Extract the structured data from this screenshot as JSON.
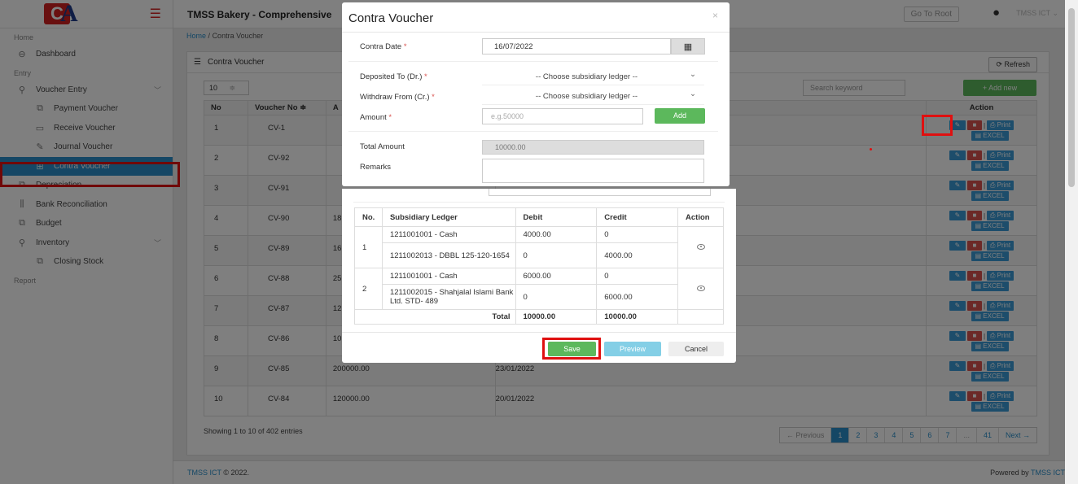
{
  "sidebar": {
    "items": [
      {
        "type": "section",
        "label": "Home"
      },
      {
        "type": "item",
        "label": "Dashboard",
        "icon": "dashboard-icon",
        "glyph": "⊖"
      },
      {
        "type": "section",
        "label": "Entry"
      },
      {
        "type": "item",
        "label": "Voucher Entry",
        "icon": "voucher-entry-icon",
        "glyph": "⚲",
        "chev": "﹀"
      },
      {
        "type": "sub",
        "label": "Payment Voucher",
        "icon": "payment-voucher-icon",
        "glyph": "⧉"
      },
      {
        "type": "sub",
        "label": "Receive Voucher",
        "icon": "receive-voucher-icon",
        "glyph": "▭"
      },
      {
        "type": "sub",
        "label": "Journal Voucher",
        "icon": "journal-voucher-icon",
        "glyph": "✎"
      },
      {
        "type": "sub",
        "label": "Contra Voucher",
        "icon": "contra-voucher-icon",
        "glyph": "⊞",
        "active": true
      },
      {
        "type": "item",
        "label": "Depreciation",
        "icon": "depreciation-icon",
        "glyph": "⧉"
      },
      {
        "type": "item",
        "label": "Bank Reconciliation",
        "icon": "bank-reconciliation-icon",
        "glyph": "⫼"
      },
      {
        "type": "item",
        "label": "Budget",
        "icon": "budget-icon",
        "glyph": "⧉"
      },
      {
        "type": "item",
        "label": "Inventory",
        "icon": "inventory-icon",
        "glyph": "⚲",
        "chev": "﹀"
      },
      {
        "type": "sub",
        "label": "Closing Stock",
        "icon": "closing-stock-icon",
        "glyph": "⧉"
      },
      {
        "type": "section",
        "label": "Report"
      }
    ]
  },
  "topbar": {
    "app_title": "TMSS Bakery - Comprehensive",
    "go_root": "Go To Root",
    "user_name": "TMSS ICT ⌄"
  },
  "breadcrumb": {
    "home": "Home",
    "sep": "/",
    "current": "Contra Voucher"
  },
  "panel": {
    "title": "Contra Voucher",
    "refresh": "Refresh",
    "page_length": "10",
    "search_placeholder": "Search keyword",
    "add_new": "+ Add new",
    "columns": [
      "No",
      "Voucher No ≑",
      "A",
      "",
      "Action"
    ],
    "rows": [
      {
        "no": "1",
        "voucher": "CV-1",
        "amount": "",
        "date": ""
      },
      {
        "no": "2",
        "voucher": "CV-92",
        "amount": "",
        "date": ""
      },
      {
        "no": "3",
        "voucher": "CV-91",
        "amount": "",
        "date": ""
      },
      {
        "no": "4",
        "voucher": "CV-90",
        "amount": "18",
        "date": ""
      },
      {
        "no": "5",
        "voucher": "CV-89",
        "amount": "16",
        "date": ""
      },
      {
        "no": "6",
        "voucher": "CV-88",
        "amount": "25",
        "date": ""
      },
      {
        "no": "7",
        "voucher": "CV-87",
        "amount": "12",
        "date": ""
      },
      {
        "no": "8",
        "voucher": "CV-86",
        "amount": "10",
        "date": ""
      },
      {
        "no": "9",
        "voucher": "CV-85",
        "amount": "200000.00",
        "date": "23/01/2022"
      },
      {
        "no": "10",
        "voucher": "CV-84",
        "amount": "120000.00",
        "date": "20/01/2022"
      }
    ],
    "action_labels": {
      "print": "Print",
      "excel": "EXCEL"
    },
    "showing": "Showing 1 to 10 of 402 entries",
    "pagination": [
      "← Previous",
      "1",
      "2",
      "3",
      "4",
      "5",
      "6",
      "7",
      "...",
      "41",
      "Next →"
    ],
    "current_page": "1"
  },
  "footer": {
    "left_link": "TMSS ICT",
    "left_rest": " © 2022.",
    "right_text": "Powered by ",
    "right_link": "TMSS ICT"
  },
  "modal": {
    "title": "Contra Voucher",
    "close": "×",
    "contra_date_label": "Contra Date",
    "contra_date_value": "16/07/2022",
    "deposited_to_label": "Deposited To (Dr.)",
    "deposited_to_value": "-- Choose subsidiary ledger --",
    "withdraw_from_label": "Withdraw From (Cr.)",
    "withdraw_from_value": "-- Choose subsidiary ledger --",
    "amount_label": "Amount",
    "amount_placeholder": "e.g.50000",
    "add_button": "Add",
    "total_amount_label": "Total Amount",
    "total_amount_value": "10000.00",
    "remarks_label": "Remarks",
    "req_mark": "*",
    "ledger": {
      "headers": [
        "No.",
        "Subsidiary Ledger",
        "Debit",
        "Credit",
        "Action"
      ],
      "groups": [
        {
          "no": "1",
          "lines": [
            {
              "ledger": "1211001001 - Cash",
              "debit": "4000.00",
              "credit": "0"
            },
            {
              "ledger": "1211002013 - DBBL 125-120-1654",
              "debit": "0",
              "credit": "4000.00"
            }
          ]
        },
        {
          "no": "2",
          "lines": [
            {
              "ledger": "1211001001 - Cash",
              "debit": "6000.00",
              "credit": "0"
            },
            {
              "ledger": "1211002015 - Shahjalal Islami Bank Ltd. STD- 489",
              "debit": "0",
              "credit": "6000.00"
            }
          ]
        }
      ],
      "total_label": "Total",
      "total_debit": "10000.00",
      "total_credit": "10000.00"
    },
    "save": "Save",
    "preview": "Preview",
    "cancel": "Cancel"
  },
  "colors": {
    "primary": "#2a8fcb",
    "success": "#5cb85c",
    "danger": "#d9534f",
    "highlight": "#e01010",
    "info": "#5bc0de"
  }
}
